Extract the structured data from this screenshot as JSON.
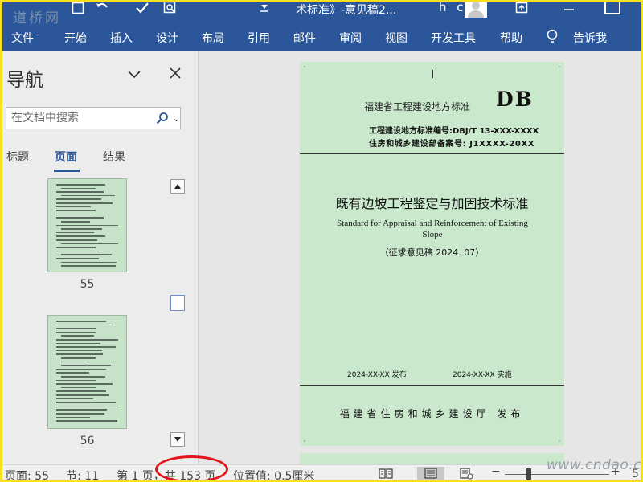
{
  "titlebar": {
    "watermark": "道桥网",
    "doc_title": "术标准》-意见稿2...",
    "user_initials": "h c"
  },
  "ribbon": {
    "tabs": [
      "文件",
      "开始",
      "插入",
      "设计",
      "布局",
      "引用",
      "邮件",
      "审阅",
      "视图",
      "开发工具",
      "帮助"
    ],
    "tell_me": "告诉我"
  },
  "nav": {
    "title": "导航",
    "search_placeholder": "在文档中搜索",
    "tabs": [
      "标题",
      "页面",
      "结果"
    ],
    "active_tab": "页面",
    "thumbnails": [
      {
        "page": "55"
      },
      {
        "page": "56"
      }
    ]
  },
  "document": {
    "header": "福建省工程建设地方标准",
    "logo": "DB",
    "standard_number": "工程建设地方标准编号:DBJ/T 13-XXX-XXXX",
    "record_number": "住房和城乡建设部备案号: J1XXXX-20XX",
    "title_cn": "既有边坡工程鉴定与加固技术标准",
    "title_en": "Standard for Appraisal and Reinforcement of Existing Slope",
    "draft_note": "（征求意见稿 2024. 07）",
    "publish_date": "2024-XX-XX  发布",
    "implement_date": "2024-XX-XX  实施",
    "publisher": "福建省住房和城乡建设厅    发布"
  },
  "statusbar": {
    "page": "页面: 55",
    "section": "节: 11",
    "page_of": "第 1 页，共 153 页",
    "position": "位置值: 0.5厘米",
    "zoom_level": "5"
  },
  "site_watermark": "www.cndao.com",
  "colors": {
    "ribbon": "#2b579a",
    "page_fill": "#c9e8cc",
    "frame": "#f5e21a",
    "highlight_ellipse": "#e3151a"
  }
}
